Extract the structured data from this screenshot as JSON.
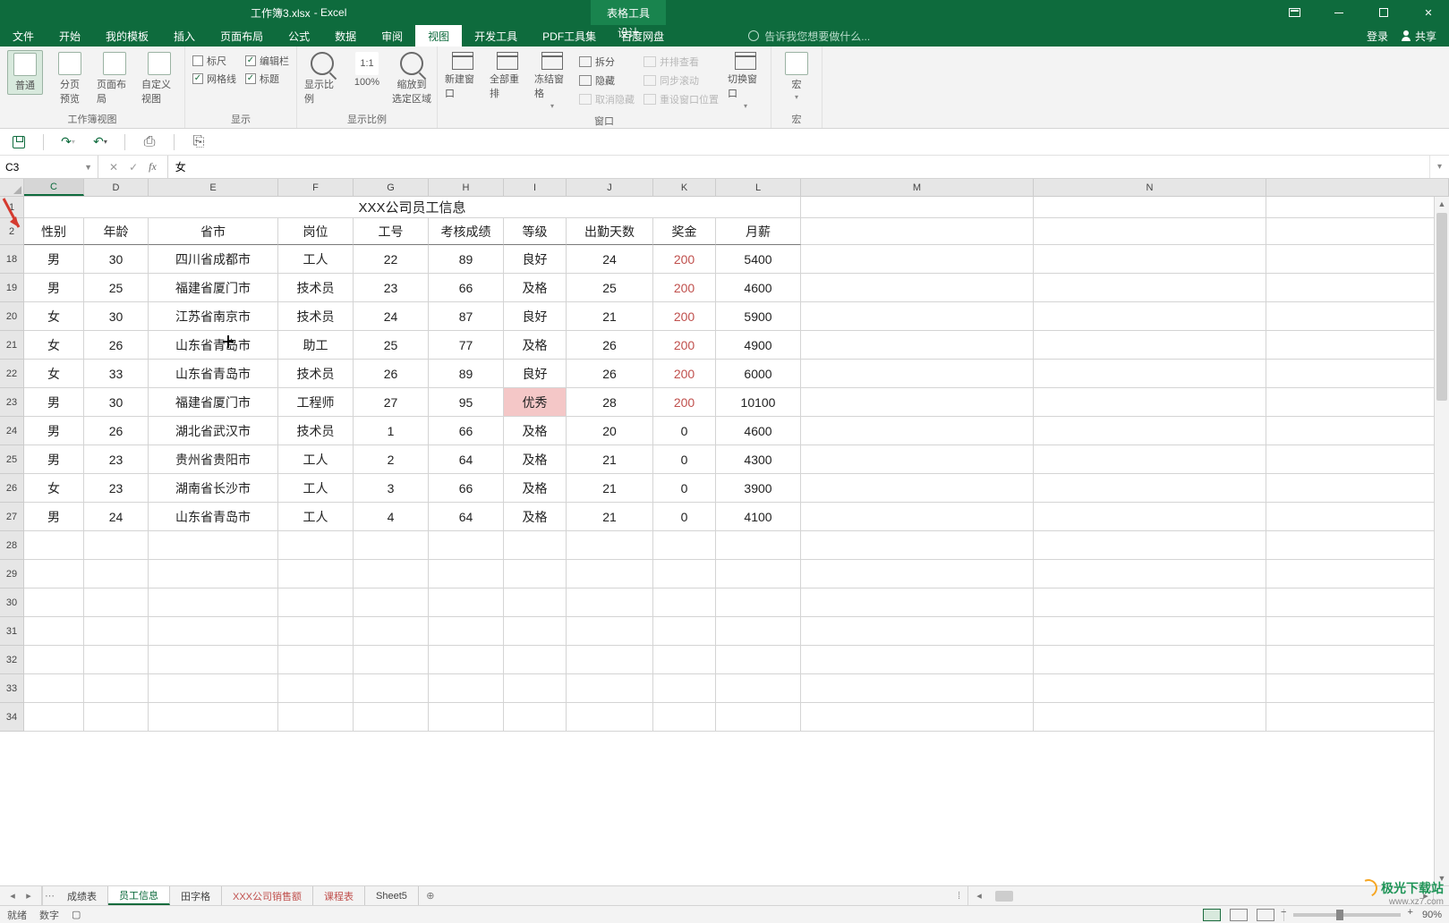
{
  "titlebar": {
    "doc": "工作簿3.xlsx",
    "app": " - Excel",
    "context": "表格工具"
  },
  "tabs": {
    "file": "文件",
    "items": [
      "开始",
      "我的模板",
      "插入",
      "页面布局",
      "公式",
      "数据",
      "审阅",
      "视图",
      "开发工具",
      "PDF工具集",
      "百度网盘"
    ],
    "active_index": 7,
    "context_tab": "设计",
    "tellme": "告诉我您想要做什么...",
    "login": "登录",
    "share": "共享"
  },
  "ribbon": {
    "g_view": {
      "normal": "普通",
      "page_break": "分页\n预览",
      "page_layout": "页面布局",
      "custom": "自定义视图",
      "label": "工作簿视图"
    },
    "g_show": {
      "ruler": "标尺",
      "formula_bar": "编辑栏",
      "gridlines": "网格线",
      "headings": "标题",
      "label": "显示"
    },
    "g_zoom": {
      "zoom": "显示比例",
      "hundred": "100%",
      "to_sel": "缩放到\n选定区域",
      "label": "显示比例"
    },
    "g_window": {
      "new": "新建窗口",
      "arrange": "全部重排",
      "freeze": "冻结窗格",
      "split": "拆分",
      "hide": "隐藏",
      "unhide": "取消隐藏",
      "side": "并排查看",
      "sync": "同步滚动",
      "reset": "重设窗口位置",
      "switch": "切换窗口",
      "label": "窗口"
    },
    "g_macro": {
      "macro": "宏",
      "label": "宏"
    }
  },
  "namebox": "C3",
  "formula": "女",
  "columns": [
    "C",
    "D",
    "E",
    "F",
    "G",
    "H",
    "I",
    "J",
    "K",
    "L",
    "M",
    "N"
  ],
  "title_merged": "XXX公司员工信息",
  "headers": [
    "性别",
    "年龄",
    "省市",
    "岗位",
    "工号",
    "考核成绩",
    "等级",
    "出勤天数",
    "奖金",
    "月薪"
  ],
  "row_labels": [
    "1",
    "2",
    "18",
    "19",
    "20",
    "21",
    "22",
    "23",
    "24",
    "25",
    "26",
    "27",
    "28",
    "29",
    "30",
    "31",
    "32",
    "33",
    "34"
  ],
  "data": [
    {
      "g": "男",
      "age": "30",
      "prov": "四川省成都市",
      "job": "工人",
      "id": "22",
      "score": "89",
      "grade": "良好",
      "days": "24",
      "bonus": "200",
      "salary": "5400"
    },
    {
      "g": "男",
      "age": "25",
      "prov": "福建省厦门市",
      "job": "技术员",
      "id": "23",
      "score": "66",
      "grade": "及格",
      "days": "25",
      "bonus": "200",
      "salary": "4600"
    },
    {
      "g": "女",
      "age": "30",
      "prov": "江苏省南京市",
      "job": "技术员",
      "id": "24",
      "score": "87",
      "grade": "良好",
      "days": "21",
      "bonus": "200",
      "salary": "5900"
    },
    {
      "g": "女",
      "age": "26",
      "prov": "山东省青岛市",
      "job": "助工",
      "id": "25",
      "score": "77",
      "grade": "及格",
      "days": "26",
      "bonus": "200",
      "salary": "4900"
    },
    {
      "g": "女",
      "age": "33",
      "prov": "山东省青岛市",
      "job": "技术员",
      "id": "26",
      "score": "89",
      "grade": "良好",
      "days": "26",
      "bonus": "200",
      "salary": "6000"
    },
    {
      "g": "男",
      "age": "30",
      "prov": "福建省厦门市",
      "job": "工程师",
      "id": "27",
      "score": "95",
      "grade": "优秀",
      "days": "28",
      "bonus": "200",
      "salary": "10100",
      "hl": true
    },
    {
      "g": "男",
      "age": "26",
      "prov": "湖北省武汉市",
      "job": "技术员",
      "id": "1",
      "score": "66",
      "grade": "及格",
      "days": "20",
      "bonus": "0",
      "salary": "4600"
    },
    {
      "g": "男",
      "age": "23",
      "prov": "贵州省贵阳市",
      "job": "工人",
      "id": "2",
      "score": "64",
      "grade": "及格",
      "days": "21",
      "bonus": "0",
      "salary": "4300"
    },
    {
      "g": "女",
      "age": "23",
      "prov": "湖南省长沙市",
      "job": "工人",
      "id": "3",
      "score": "66",
      "grade": "及格",
      "days": "21",
      "bonus": "0",
      "salary": "3900"
    },
    {
      "g": "男",
      "age": "24",
      "prov": "山东省青岛市",
      "job": "工人",
      "id": "4",
      "score": "64",
      "grade": "及格",
      "days": "21",
      "bonus": "0",
      "salary": "4100"
    }
  ],
  "sheets": {
    "items": [
      "成绩表",
      "员工信息",
      "田字格",
      "XXX公司销售额",
      "课程表",
      "Sheet5"
    ],
    "active_index": 1,
    "accent_indices": [
      3,
      4
    ]
  },
  "status": {
    "ready": "就绪",
    "mode": "数字",
    "rec": "",
    "zoom": "90%"
  },
  "watermark": {
    "name": "极光下载站",
    "url": "www.xz7.com"
  }
}
